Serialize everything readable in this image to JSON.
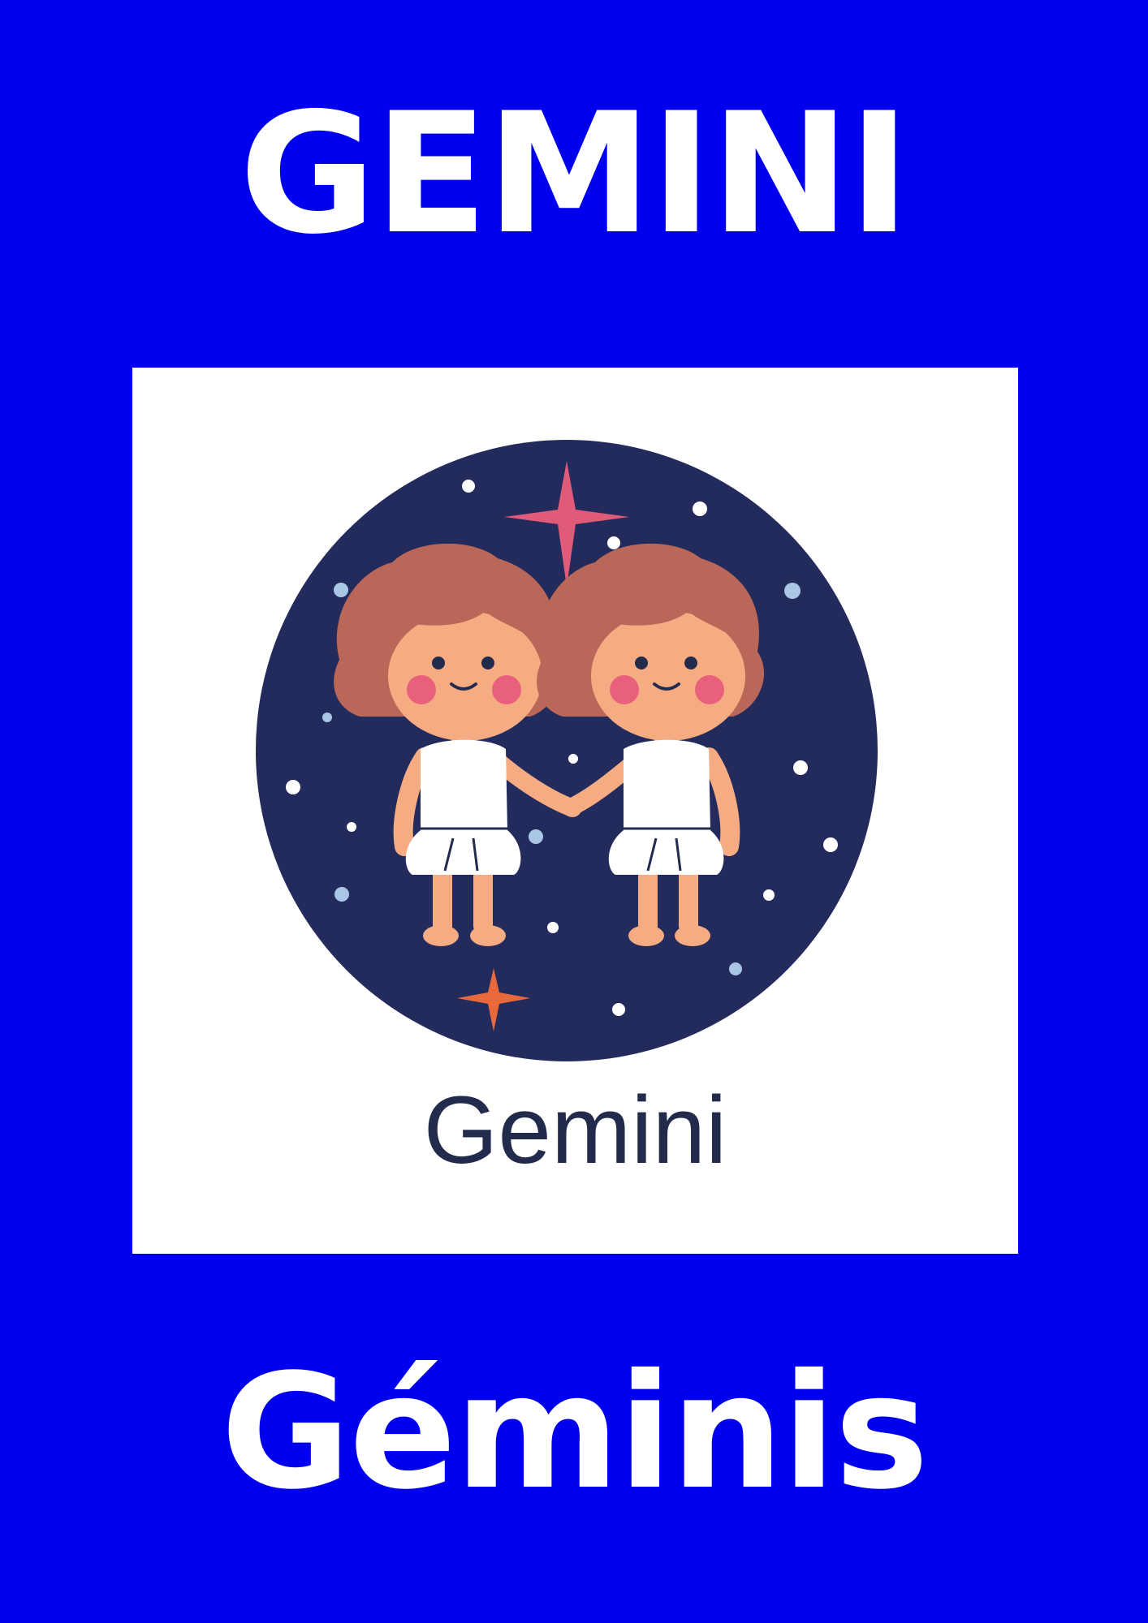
{
  "header": {
    "title": "GEMINI"
  },
  "illustration": {
    "caption": "Gemini",
    "icon": "gemini-twins-illustration"
  },
  "footer": {
    "title": "Géminis"
  },
  "colors": {
    "background": "#0000ee",
    "title_text": "#ffffff",
    "card": "#ffffff",
    "circle": "#232b5c",
    "caption_text": "#232b4d",
    "star_pink": "#e05a7a",
    "star_orange": "#e86a3c",
    "hair": "#b96758",
    "skin": "#f6ac83"
  }
}
